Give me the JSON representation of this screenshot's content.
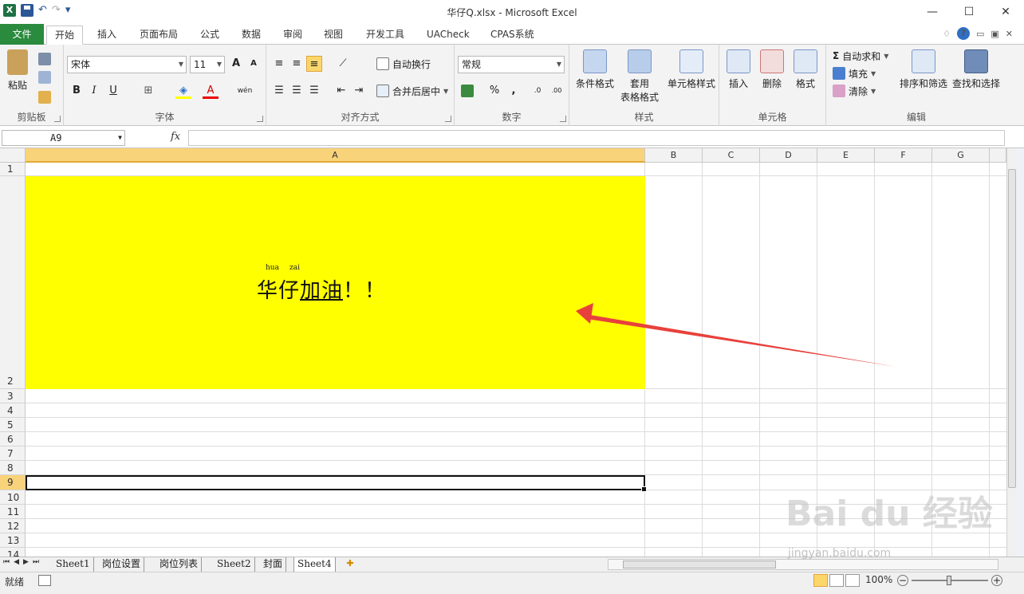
{
  "window": {
    "title": "华仔Q.xlsx - Microsoft Excel",
    "minimize": "—",
    "restore": "☐",
    "close": "✕"
  },
  "qat": {
    "logo": "X",
    "undo": "↶",
    "redo": "↷",
    "customize": "▾"
  },
  "tabs": [
    {
      "label": "文件"
    },
    {
      "label": "开始"
    },
    {
      "label": "插入"
    },
    {
      "label": "页面布局"
    },
    {
      "label": "公式"
    },
    {
      "label": "数据"
    },
    {
      "label": "审阅"
    },
    {
      "label": "视图"
    },
    {
      "label": "开发工具"
    },
    {
      "label": "UACheck"
    },
    {
      "label": "CPAS系统"
    }
  ],
  "tabs_right": {
    "collapse": "♢",
    "help": "?",
    "min": "▭",
    "restore": "▣",
    "close": "✕"
  },
  "ribbon": {
    "clipboard": {
      "label": "剪贴板",
      "paste": "粘贴"
    },
    "font": {
      "label": "字体",
      "name": "宋体",
      "size": "11",
      "grow": "A",
      "shrink": "A",
      "bold": "B",
      "italic": "I",
      "underline": "U",
      "border": "⊞",
      "fill": "◈",
      "color": "A",
      "phonetic": "wén"
    },
    "alignment": {
      "label": "对齐方式",
      "wrap": "自动换行",
      "merge": "合并后居中"
    },
    "number": {
      "label": "数字",
      "format": "常规",
      "percent": "%",
      "comma": ",",
      "inc_decimal": ".0",
      "dec_decimal": ".00"
    },
    "styles": {
      "label": "样式",
      "conditional": "条件格式",
      "table1": "套用",
      "table2": "表格格式",
      "cell_styles": "单元格样式"
    },
    "cells": {
      "label": "单元格",
      "insert": "插入",
      "delete": "删除",
      "format": "格式"
    },
    "editing": {
      "label": "编辑",
      "autosum_icon": "Σ",
      "autosum": "自动求和",
      "fill": "填充",
      "clear": "清除",
      "sort": "排序和筛选",
      "find": "查找和选择"
    }
  },
  "formula_bar": {
    "name_box": "A9",
    "fx": "fx",
    "value": ""
  },
  "grid": {
    "columns": [
      "A",
      "B",
      "C",
      "D",
      "E",
      "F",
      "G"
    ],
    "rows": [
      "1",
      "2",
      "3",
      "4",
      "5",
      "6",
      "7",
      "8",
      "9",
      "10",
      "11",
      "12",
      "13",
      "14"
    ],
    "selected_cell": "A9",
    "cell_a2": {
      "phonetic_1": "hua",
      "phonetic_2": "zai",
      "text_plain": "华仔",
      "text_underlined": "加油",
      "text_end": "！！",
      "fill_color": "#ffff00"
    }
  },
  "sheets": [
    "Sheet1",
    "岗位设置",
    "岗位列表",
    "Sheet2",
    "封面",
    "Sheet4"
  ],
  "active_sheet": "Sheet4",
  "status": {
    "ready": "就绪",
    "zoom": "100%"
  },
  "watermark": {
    "line1": "Bai du 经验",
    "line2": "jingyan.baidu.com"
  },
  "accent": {
    "excel_green": "#2a8a3e",
    "selection_header": "#f9d37a",
    "arrow": "#e8413c"
  }
}
